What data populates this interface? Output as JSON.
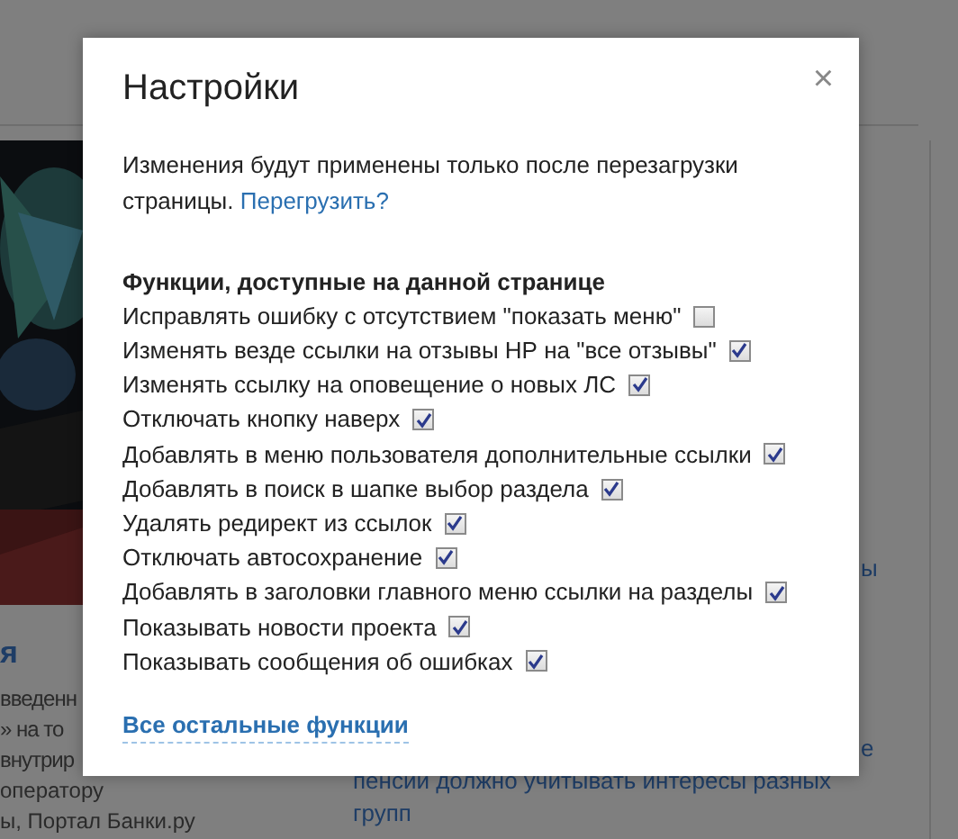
{
  "background": {
    "left_heading": "я",
    "left_lines": [
      "введенн",
      "» на то",
      "внутрир",
      "оператору",
      "ы, Портал Банки.ру"
    ],
    "right_fragments": [
      "ы",
      "е"
    ],
    "right_lines": [
      "пенсии должно учитывать интересы разных",
      "групп"
    ]
  },
  "dialog": {
    "title": "Настройки",
    "close": "×",
    "notice": "Изменения будут применены только после перезагрузки страницы.",
    "reload_link": "Перегрузить?",
    "section_title": "Функции, доступные на данной странице",
    "options": [
      {
        "label": "Исправлять ошибку с отсутствием \"показать меню\"",
        "checked": false
      },
      {
        "label": "Изменять везде ссылки на отзывы НР на \"все отзывы\"",
        "checked": true
      },
      {
        "label": "Изменять ссылку на оповещение о новых ЛС",
        "checked": true
      },
      {
        "label": "Отключать кнопку наверх",
        "checked": true
      },
      {
        "label": "Добавлять в меню пользователя дополнительные ссылки",
        "checked": true
      },
      {
        "label": "Добавлять в поиск в шапке выбор раздела",
        "checked": true
      },
      {
        "label": "Удалять редирект из ссылок",
        "checked": true
      },
      {
        "label": "Отключать автосохранение",
        "checked": true
      },
      {
        "label": "Добавлять в заголовки главного меню ссылки на разделы",
        "checked": true
      },
      {
        "label": "Показывать новости проекта",
        "checked": true
      },
      {
        "label": "Показывать сообщения об ошибках",
        "checked": true
      }
    ],
    "more_link": "Все остальные функции"
  }
}
